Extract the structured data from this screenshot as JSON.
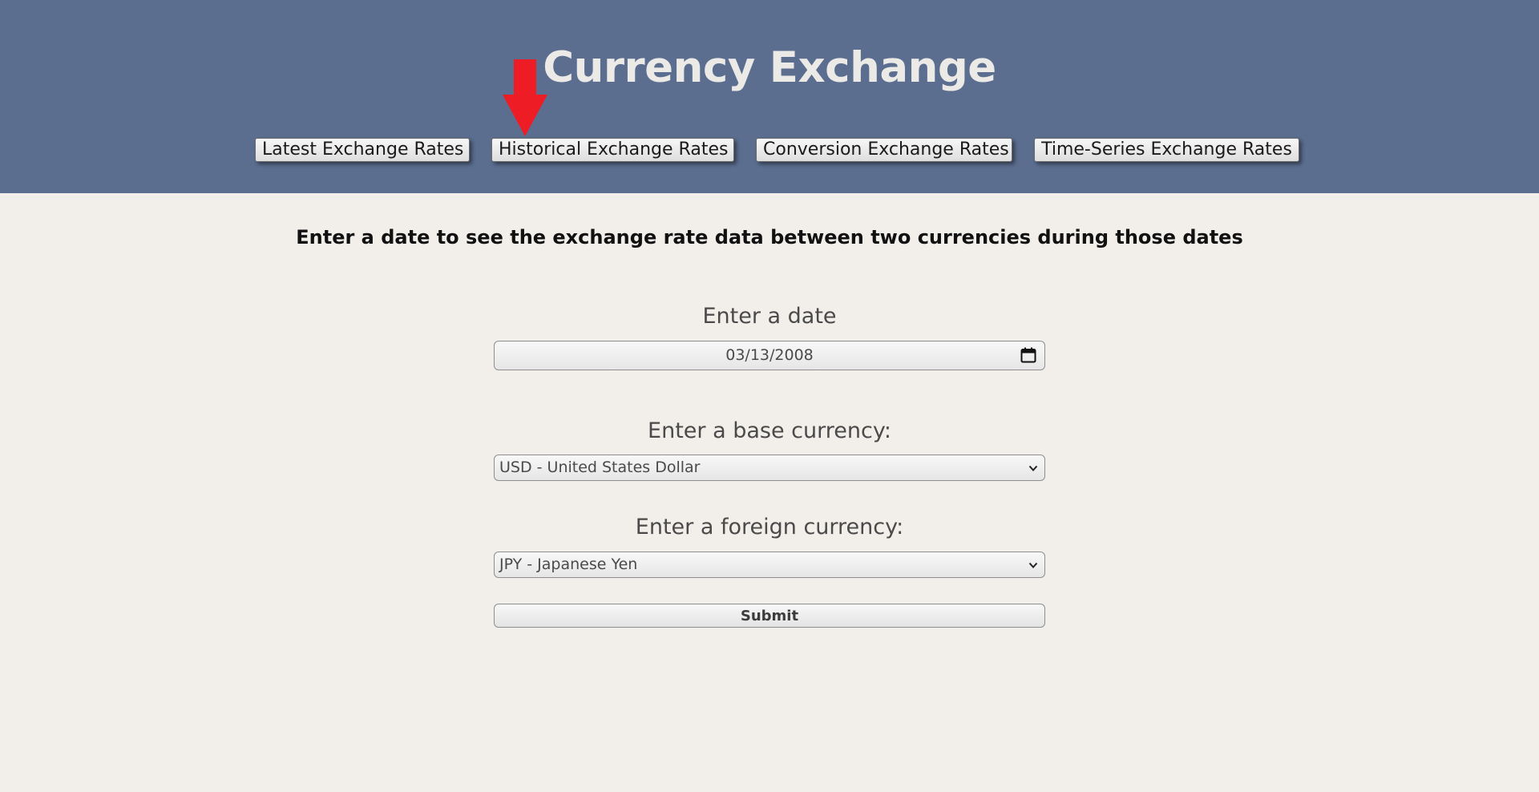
{
  "header": {
    "title": "Currency Exchange",
    "background": "#5b6e90",
    "nav": [
      {
        "label": "Latest Exchange Rates"
      },
      {
        "label": "Historical Exchange Rates"
      },
      {
        "label": "Conversion Exchange Rates"
      },
      {
        "label": "Time-Series Exchange Rates"
      }
    ],
    "annotation_arrow_color": "#ee1c25"
  },
  "main": {
    "instructions": "Enter a date to see the exchange rate data between two currencies during those dates",
    "date": {
      "label": "Enter a date",
      "value": "03/13/2008"
    },
    "base_currency": {
      "label": "Enter a base currency:",
      "value": "USD - United States Dollar"
    },
    "foreign_currency": {
      "label": "Enter a foreign currency:",
      "value": "JPY - Japanese Yen"
    },
    "submit_label": "Submit"
  }
}
